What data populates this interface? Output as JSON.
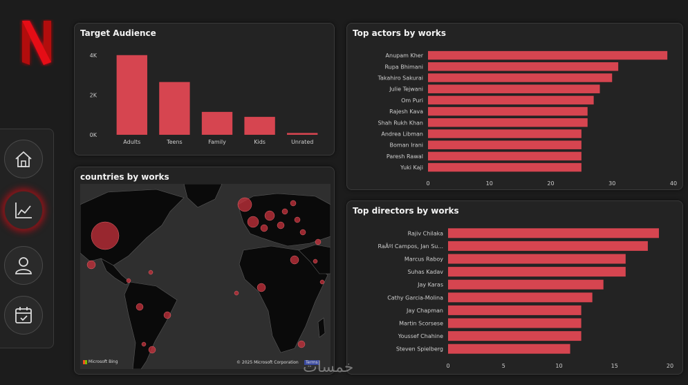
{
  "brand": {
    "logo_letter": "N",
    "accent": "#E50914"
  },
  "nav": {
    "items": [
      {
        "name": "home-icon",
        "active": false
      },
      {
        "name": "chart-icon",
        "active": true
      },
      {
        "name": "user-icon",
        "active": false
      },
      {
        "name": "calendar-icon",
        "active": false
      }
    ]
  },
  "cards": {
    "target_audience": {
      "title": "Target Audience"
    },
    "countries": {
      "title": "countries by works",
      "bing_logo": "Microsoft Bing",
      "credit": "© 2025 Microsoft Corporation",
      "terms": "Terms"
    },
    "top_actors": {
      "title": "Top actors by works"
    },
    "top_directors": {
      "title": "Top directors by works"
    }
  },
  "watermark": "خمسات",
  "colors": {
    "bar": "#D64550",
    "map_bubble": "#C8323C",
    "background": "#1C1C1C",
    "card": "#232323"
  },
  "chart_data": [
    {
      "id": "audience",
      "type": "bar",
      "categories": [
        "Adults",
        "Teens",
        "Family",
        "Kids",
        "Unrated"
      ],
      "values": [
        4000,
        2650,
        1150,
        900,
        90
      ],
      "yticks": [
        "0K",
        "2K",
        "4K"
      ],
      "ytick_values": [
        0,
        2000,
        4000
      ],
      "ylim": [
        0,
        4200
      ]
    },
    {
      "id": "actors",
      "type": "bar",
      "orientation": "horizontal",
      "categories": [
        "Anupam Kher",
        "Rupa Bhimani",
        "Takahiro Sakurai",
        "Julie Tejwani",
        "Om Puri",
        "Rajesh Kava",
        "Shah Rukh Khan",
        "Andrea Libman",
        "Boman Irani",
        "Paresh Rawal",
        "Yuki Kaji"
      ],
      "values": [
        39,
        31,
        30,
        28,
        27,
        26,
        26,
        25,
        25,
        25,
        25
      ],
      "xticks": [
        "0",
        "10",
        "20",
        "30",
        "40"
      ],
      "xtick_values": [
        0,
        10,
        20,
        30,
        40
      ],
      "xlim": [
        0,
        40
      ]
    },
    {
      "id": "directors",
      "type": "bar",
      "orientation": "horizontal",
      "categories": [
        "Rajiv Chilaka",
        "RaÃºl Campos, Jan Su...",
        "Marcus Raboy",
        "Suhas Kadav",
        "Jay Karas",
        "Cathy Garcia-Molina",
        "Jay Chapman",
        "Martin Scorsese",
        "Youssef Chahine",
        "Steven Spielberg"
      ],
      "values": [
        19,
        18,
        16,
        16,
        14,
        13,
        12,
        12,
        12,
        11
      ],
      "xticks": [
        "0",
        "5",
        "10",
        "15",
        "20"
      ],
      "xtick_values": [
        0,
        5,
        10,
        15,
        20
      ],
      "xlim": [
        0,
        20
      ]
    }
  ]
}
